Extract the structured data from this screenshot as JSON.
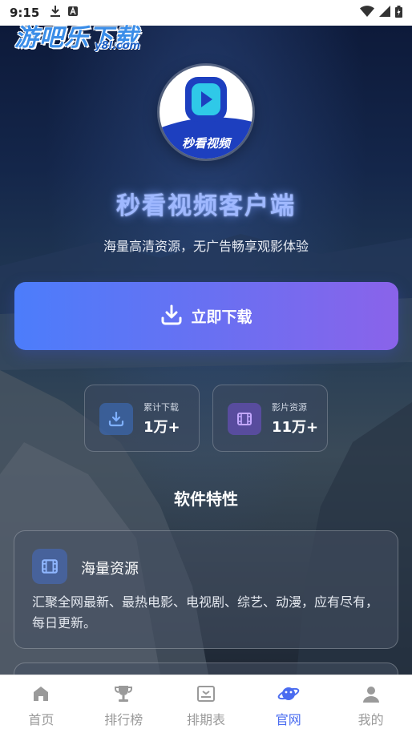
{
  "status_bar": {
    "time": "9:15",
    "icons_left": [
      "download-icon",
      "a-icon"
    ],
    "icons_right": [
      "wifi-icon",
      "signal-icon",
      "battery-icon"
    ]
  },
  "watermark": {
    "main": "游吧乐下载",
    "sub": "y8l.com"
  },
  "app": {
    "logo_text": "秒看视频",
    "title": "秒看视频客户端",
    "subtitle": "海量高清资源，无广告畅享观影体验"
  },
  "download_button": {
    "label": "立即下载"
  },
  "stats": [
    {
      "label": "累计下载",
      "value": "1万+",
      "icon": "download-icon"
    },
    {
      "label": "影片资源",
      "value": "11万+",
      "icon": "film-icon"
    }
  ],
  "features": {
    "section_title": "软件特性",
    "items": [
      {
        "title": "海量资源",
        "icon": "film-icon",
        "description": "汇聚全网最新、最热电影、电视剧、综艺、动漫，应有尽有，每日更新。"
      }
    ]
  },
  "bottom_nav": {
    "items": [
      {
        "label": "首页",
        "icon": "home-icon",
        "active": false
      },
      {
        "label": "排行榜",
        "icon": "trophy-icon",
        "active": false
      },
      {
        "label": "排期表",
        "icon": "schedule-icon",
        "active": false
      },
      {
        "label": "官网",
        "icon": "planet-icon",
        "active": true
      },
      {
        "label": "我的",
        "icon": "user-icon",
        "active": false
      }
    ]
  },
  "colors": {
    "accent": "#4a6cf0",
    "button_start": "#4c7dfb",
    "button_end": "#8a63ea",
    "title_glow": "#9fb8ff"
  }
}
